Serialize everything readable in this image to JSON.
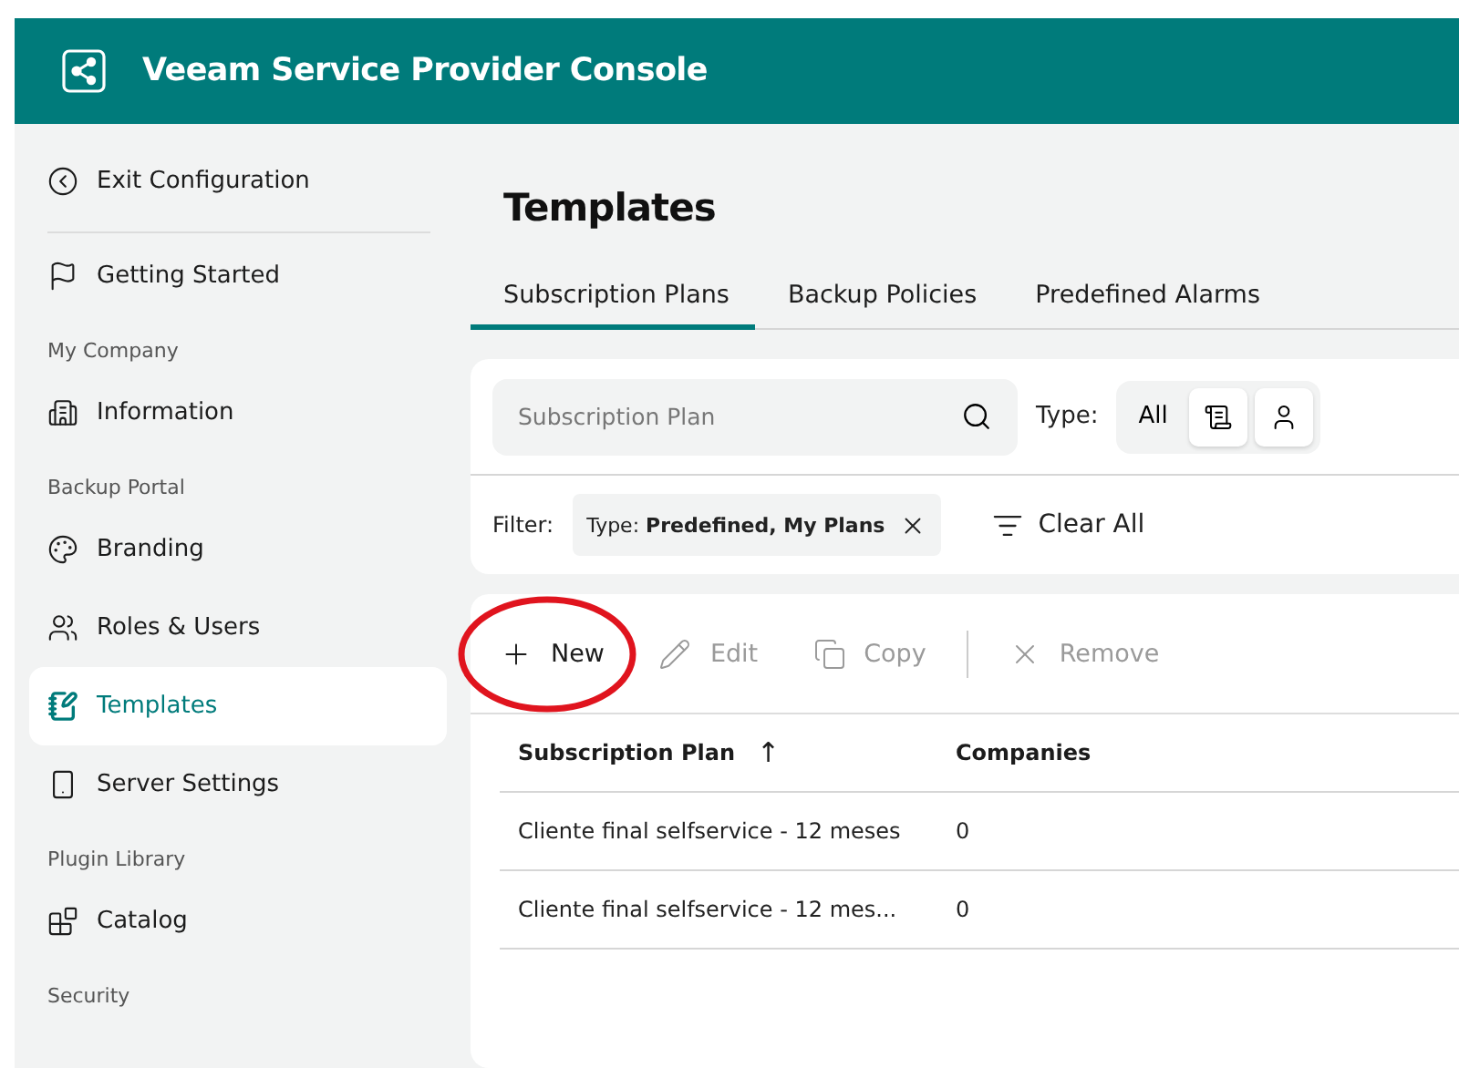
{
  "header": {
    "title": "Veeam Service Provider Console"
  },
  "sidebar": {
    "exit": "Exit Configuration",
    "items": [
      {
        "kind": "item",
        "label": "Getting Started",
        "selected": false
      },
      {
        "kind": "section",
        "label": "My Company"
      },
      {
        "kind": "item",
        "label": "Information",
        "selected": false
      },
      {
        "kind": "section",
        "label": "Backup Portal"
      },
      {
        "kind": "item",
        "label": "Branding",
        "selected": false
      },
      {
        "kind": "item",
        "label": "Roles & Users",
        "selected": false
      },
      {
        "kind": "item",
        "label": "Templates",
        "selected": true
      },
      {
        "kind": "item",
        "label": "Server Settings",
        "selected": false
      },
      {
        "kind": "section",
        "label": "Plugin Library"
      },
      {
        "kind": "item",
        "label": "Catalog",
        "selected": false
      },
      {
        "kind": "section",
        "label": "Security"
      }
    ]
  },
  "page": {
    "title": "Templates"
  },
  "tabs": [
    {
      "label": "Subscription Plans",
      "selected": true
    },
    {
      "label": "Backup Policies",
      "selected": false
    },
    {
      "label": "Predefined Alarms",
      "selected": false
    }
  ],
  "search": {
    "placeholder": "Subscription Plan"
  },
  "type_filter": {
    "label": "Type:",
    "options": [
      {
        "kind": "text",
        "label": "All"
      },
      {
        "kind": "predefined"
      },
      {
        "kind": "mine"
      }
    ]
  },
  "filter": {
    "label": "Filter:",
    "chip": "Type: **Predefined, My Plans**",
    "clear": "Clear All"
  },
  "toolbar": [
    {
      "kind": "button",
      "label": "New",
      "disabled": false,
      "circled": true
    },
    {
      "kind": "button",
      "label": "Edit",
      "disabled": true,
      "circled": false
    },
    {
      "kind": "button",
      "label": "Copy",
      "disabled": true,
      "circled": false
    },
    {
      "kind": "separator"
    },
    {
      "kind": "button",
      "label": "Remove",
      "disabled": true,
      "circled": false
    }
  ],
  "table": {
    "columns": [
      {
        "label": "Subscription Plan",
        "sort": "↑"
      },
      {
        "label": "Companies"
      }
    ],
    "rows": [
      [
        "Cliente final selfservice - 12 meses",
        "0"
      ],
      [
        "Cliente final selfservice - 12 mes...",
        "0"
      ]
    ]
  }
}
